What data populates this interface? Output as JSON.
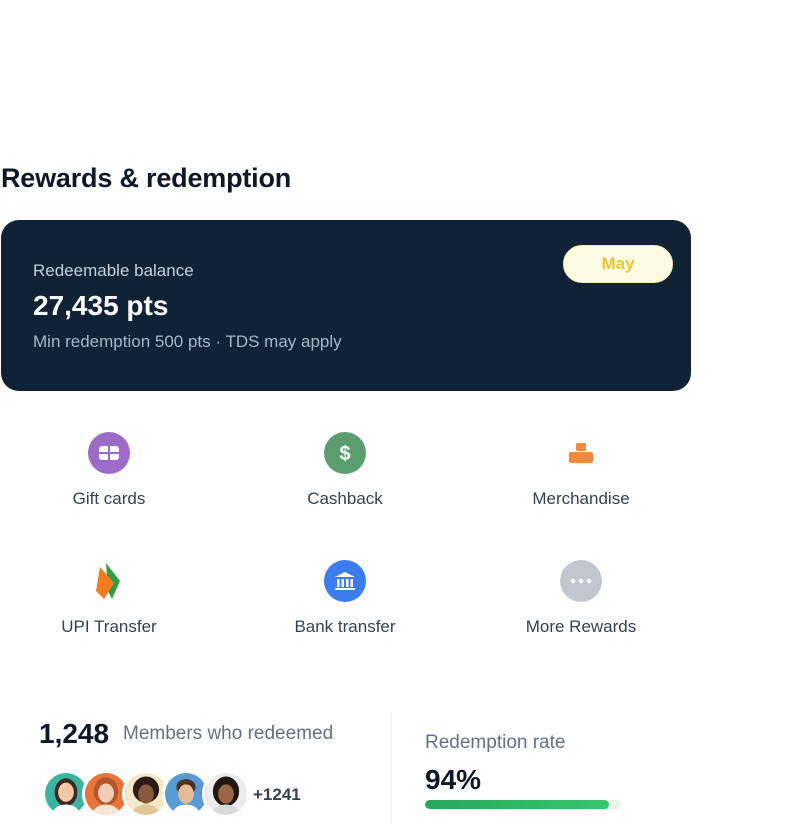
{
  "section": {
    "title": "Rewards & redemption"
  },
  "balance": {
    "label": "Redeemable balance",
    "value": "27,435 pts",
    "note": "Min redemption 500 pts · TDS may apply",
    "month": "May"
  },
  "options": [
    {
      "label": "Gift cards",
      "icon": "gift-card-icon",
      "color": "#9b6bc7"
    },
    {
      "label": "Cashback",
      "icon": "dollar-icon",
      "color": "#5a9e6f"
    },
    {
      "label": "Merchandise",
      "icon": "box-icon",
      "color": "#f08a3c"
    },
    {
      "label": "UPI Transfer",
      "icon": "upi-logo-icon",
      "color": "#f47c20"
    },
    {
      "label": "Bank transfer",
      "icon": "bank-icon",
      "color": "#3b7df0"
    },
    {
      "label": "More Rewards",
      "icon": "more-dots-icon",
      "color": "#c2c7cf"
    }
  ],
  "members": {
    "count": "1,248",
    "label": "Members who redeemed",
    "extra": "+1241"
  },
  "redemption": {
    "label": "Redemption rate",
    "value": "94%",
    "fraction": 0.94
  },
  "colors": {
    "card_bg": "#0f2236",
    "accent_yellow": "#e8c531",
    "progress_green": "#2aa75a"
  }
}
